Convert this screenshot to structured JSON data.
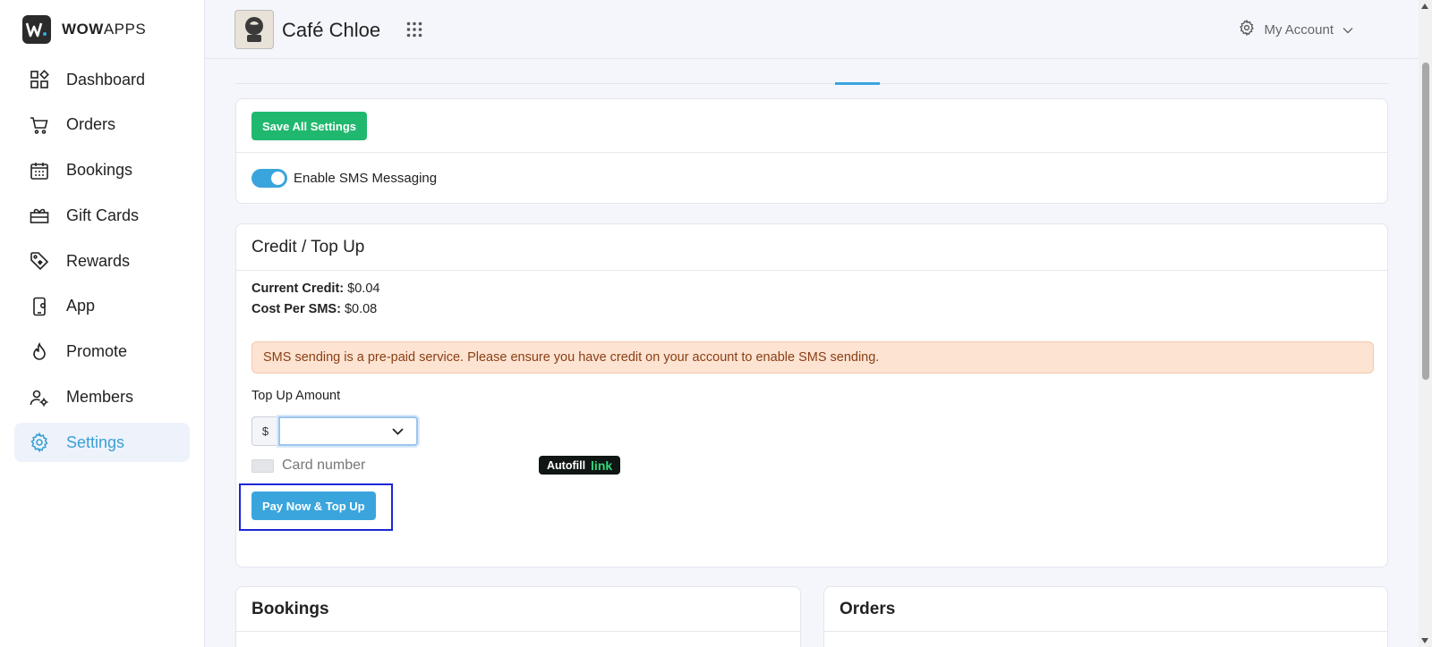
{
  "brand": {
    "bold": "WOW",
    "rest": "APPS"
  },
  "sidebar": {
    "items": [
      {
        "label": "Dashboard",
        "icon": "dashboard-icon"
      },
      {
        "label": "Orders",
        "icon": "cart-icon"
      },
      {
        "label": "Bookings",
        "icon": "calendar-icon"
      },
      {
        "label": "Gift Cards",
        "icon": "gift-card-icon"
      },
      {
        "label": "Rewards",
        "icon": "tag-icon"
      },
      {
        "label": "App",
        "icon": "phone-icon"
      },
      {
        "label": "Promote",
        "icon": "flame-icon"
      },
      {
        "label": "Members",
        "icon": "members-icon"
      },
      {
        "label": "Settings",
        "icon": "gear-icon",
        "active": true
      }
    ]
  },
  "header": {
    "store_name": "Café Chloe",
    "account_label": "My Account"
  },
  "sms": {
    "save_label": "Save All Settings",
    "toggle_label": "Enable SMS Messaging",
    "toggle_on": true
  },
  "credit": {
    "title": "Credit / Top Up",
    "current_credit_label": "Current Credit:",
    "current_credit_value": "$0.04",
    "cost_per_sms_label": "Cost Per SMS:",
    "cost_per_sms_value": "$0.08",
    "alert": "SMS sending is a pre-paid service. Please ensure you have credit on your account to enable SMS sending.",
    "top_up_label": "Top Up Amount",
    "currency_symbol": "$",
    "card_placeholder": "Card number",
    "autofill_label": "Autofill",
    "autofill_link": "link",
    "pay_button": "Pay Now & Top Up"
  },
  "sections": {
    "bookings_title": "Bookings",
    "orders_title": "Orders"
  },
  "colors": {
    "accent": "#3aa5dd",
    "save_green": "#20b86e",
    "alert_bg": "#fde3d2"
  }
}
